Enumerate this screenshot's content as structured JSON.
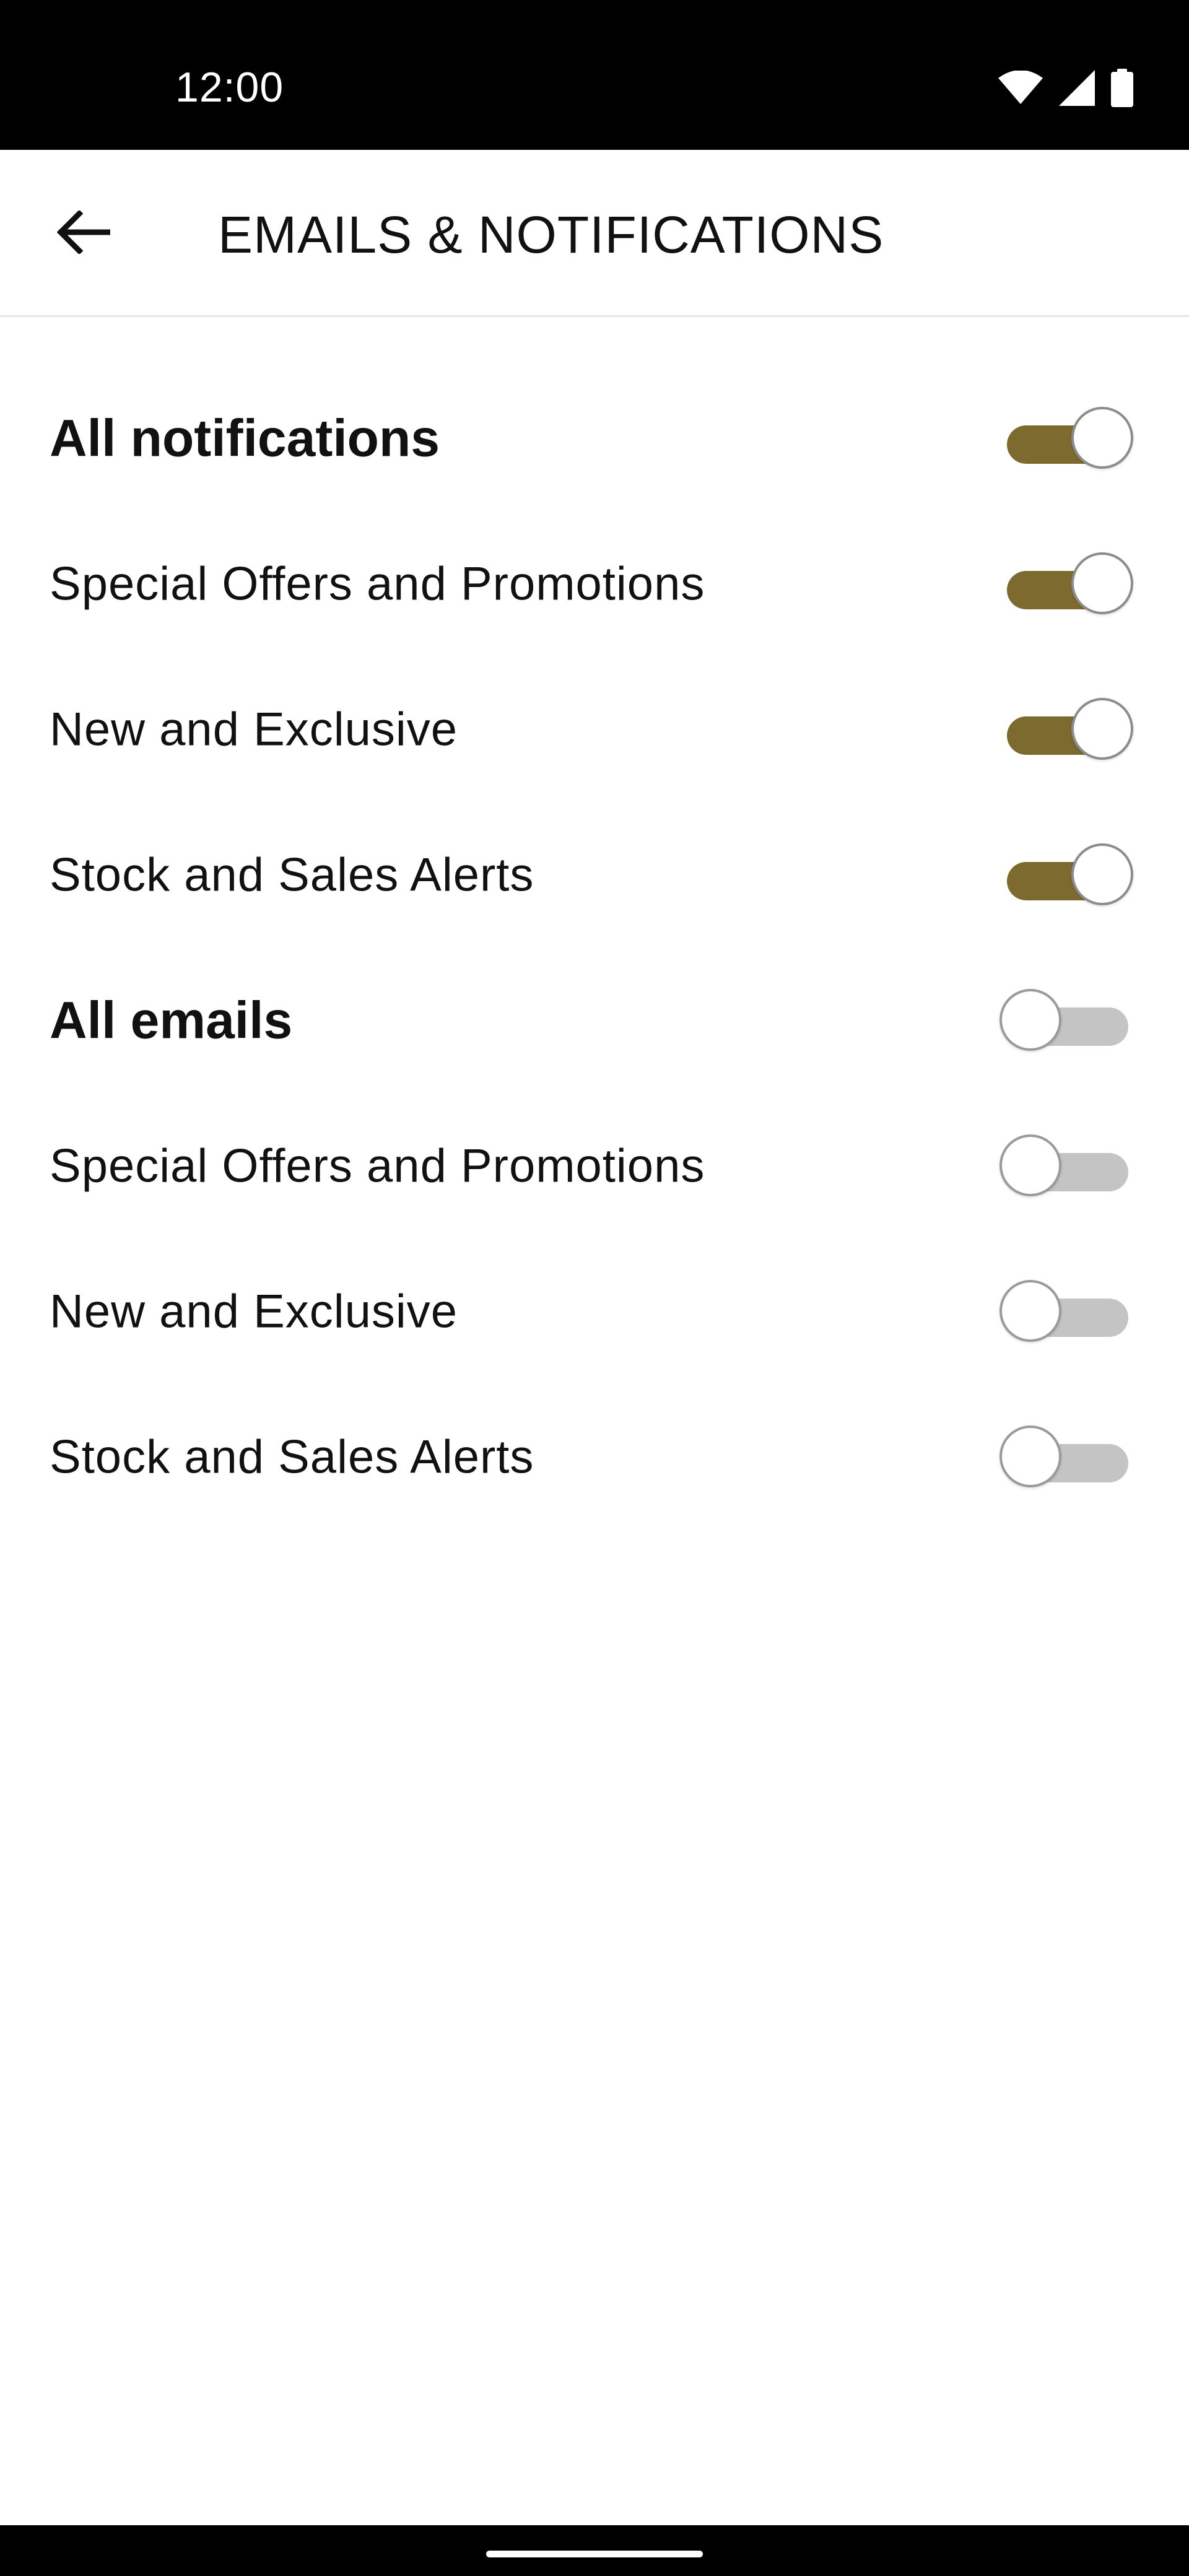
{
  "status_bar": {
    "time": "12:00",
    "icons": [
      "wifi-icon",
      "signal-icon",
      "battery-icon"
    ]
  },
  "header": {
    "title": "EMAILS & NOTIFICATIONS",
    "back_icon": "arrow-left-icon"
  },
  "colors": {
    "accent": "#7d6a2e",
    "toggle_off_track": "#c4c4c4"
  },
  "settings": [
    {
      "label": "All notifications",
      "bold": true,
      "enabled": true
    },
    {
      "label": "Special Offers and Promotions",
      "bold": false,
      "enabled": true
    },
    {
      "label": "New and Exclusive",
      "bold": false,
      "enabled": true
    },
    {
      "label": "Stock and Sales Alerts",
      "bold": false,
      "enabled": true
    },
    {
      "label": "All emails",
      "bold": true,
      "enabled": false
    },
    {
      "label": "Special Offers and Promotions",
      "bold": false,
      "enabled": false
    },
    {
      "label": "New and Exclusive",
      "bold": false,
      "enabled": false
    },
    {
      "label": "Stock and Sales Alerts",
      "bold": false,
      "enabled": false
    }
  ]
}
